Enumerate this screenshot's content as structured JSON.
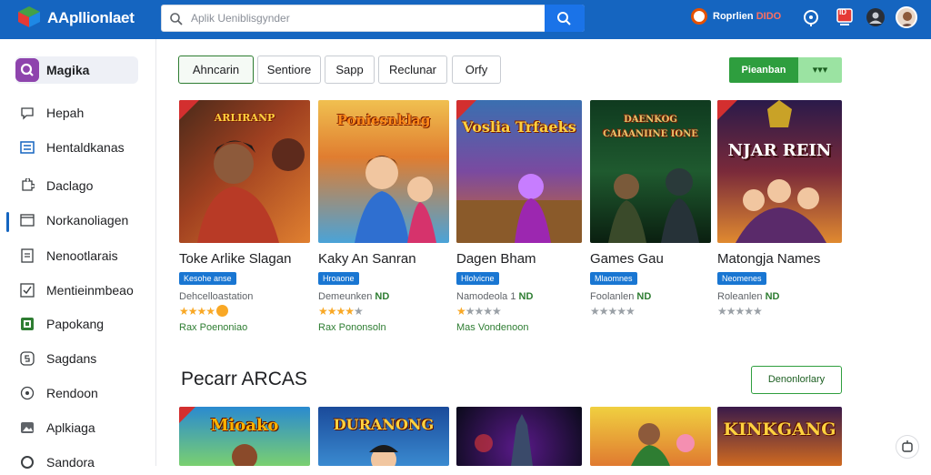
{
  "app": {
    "title": "AApllionlaet"
  },
  "search": {
    "placeholder": "Aplik Ueniblisgynder"
  },
  "header": {
    "promo_label": "Roprlien",
    "promo_accent": "DIDO",
    "cart_badge": "ID"
  },
  "sidebar": {
    "active": "Magika",
    "items": [
      {
        "label": "Hepah",
        "icon": "chat-icon"
      },
      {
        "label": "Hentaldkanas",
        "icon": "list-icon"
      },
      {
        "label": "Daclago",
        "icon": "puzzle-icon"
      },
      {
        "label": "Norkanoliagen",
        "icon": "window-icon"
      },
      {
        "label": "Nenootlarais",
        "icon": "document-icon"
      },
      {
        "label": "Mentieinmbeao",
        "icon": "check-icon"
      },
      {
        "label": "Papokang",
        "icon": "app-icon"
      },
      {
        "label": "Sagdans",
        "icon": "storage-icon"
      },
      {
        "label": "Rendoon",
        "icon": "compass-icon"
      },
      {
        "label": "Aplkiaga",
        "icon": "image-icon"
      },
      {
        "label": "Sandora",
        "icon": "circle-icon"
      }
    ]
  },
  "filters": [
    "Ahncarin",
    "Sentiore",
    "Sapp",
    "Reclunar",
    "Orfy"
  ],
  "actions": {
    "primary": "Pieanban",
    "secondary": "▾▾▾"
  },
  "colors": {
    "accent": "#1565c0",
    "green": "#2e9e3e"
  },
  "games": [
    {
      "name": "Toke Arlike Slagan",
      "badge": "Kesohe anse",
      "dev": "Dehcelloastation",
      "dev_tag": "",
      "stars": "★★★★",
      "stars_grey": "",
      "free": "Rax Poenoniao",
      "thumb_title": "ARLIRANP"
    },
    {
      "name": "Kaky An Sanran",
      "badge": "Hroaone",
      "dev": "Demeunken",
      "dev_tag": "ND",
      "stars": "★★★★",
      "stars_grey": "★",
      "free": "Rax Pononsoln",
      "thumb_title": "Poniesnklag"
    },
    {
      "name": "Dagen Bham",
      "badge": "Hlolvicne",
      "dev": "Namodeola 1",
      "dev_tag": "ND",
      "stars": "★",
      "stars_grey": "★★★★",
      "free": "Mas Vondenoon",
      "thumb_title": "Voslia Trfaeks"
    },
    {
      "name": "Games Gau",
      "badge": "Mlaomnes",
      "dev": "Foolanlen",
      "dev_tag": "ND",
      "stars": "",
      "stars_grey": "★★★★★",
      "free": "",
      "thumb_title": "DAENKOG CAIAANIINE IONE"
    },
    {
      "name": "Matongja Names",
      "badge": "Neomenes",
      "dev": "Roleanlen",
      "dev_tag": "ND",
      "stars": "",
      "stars_grey": "★★★★★",
      "free": "",
      "thumb_title": "NJAR REIN"
    }
  ],
  "section": {
    "title": "Pecarr ARCAS",
    "button": "Denonlorlary"
  },
  "games2": [
    "Mioako",
    "DURANONG",
    "",
    "",
    "KINKGANG"
  ]
}
